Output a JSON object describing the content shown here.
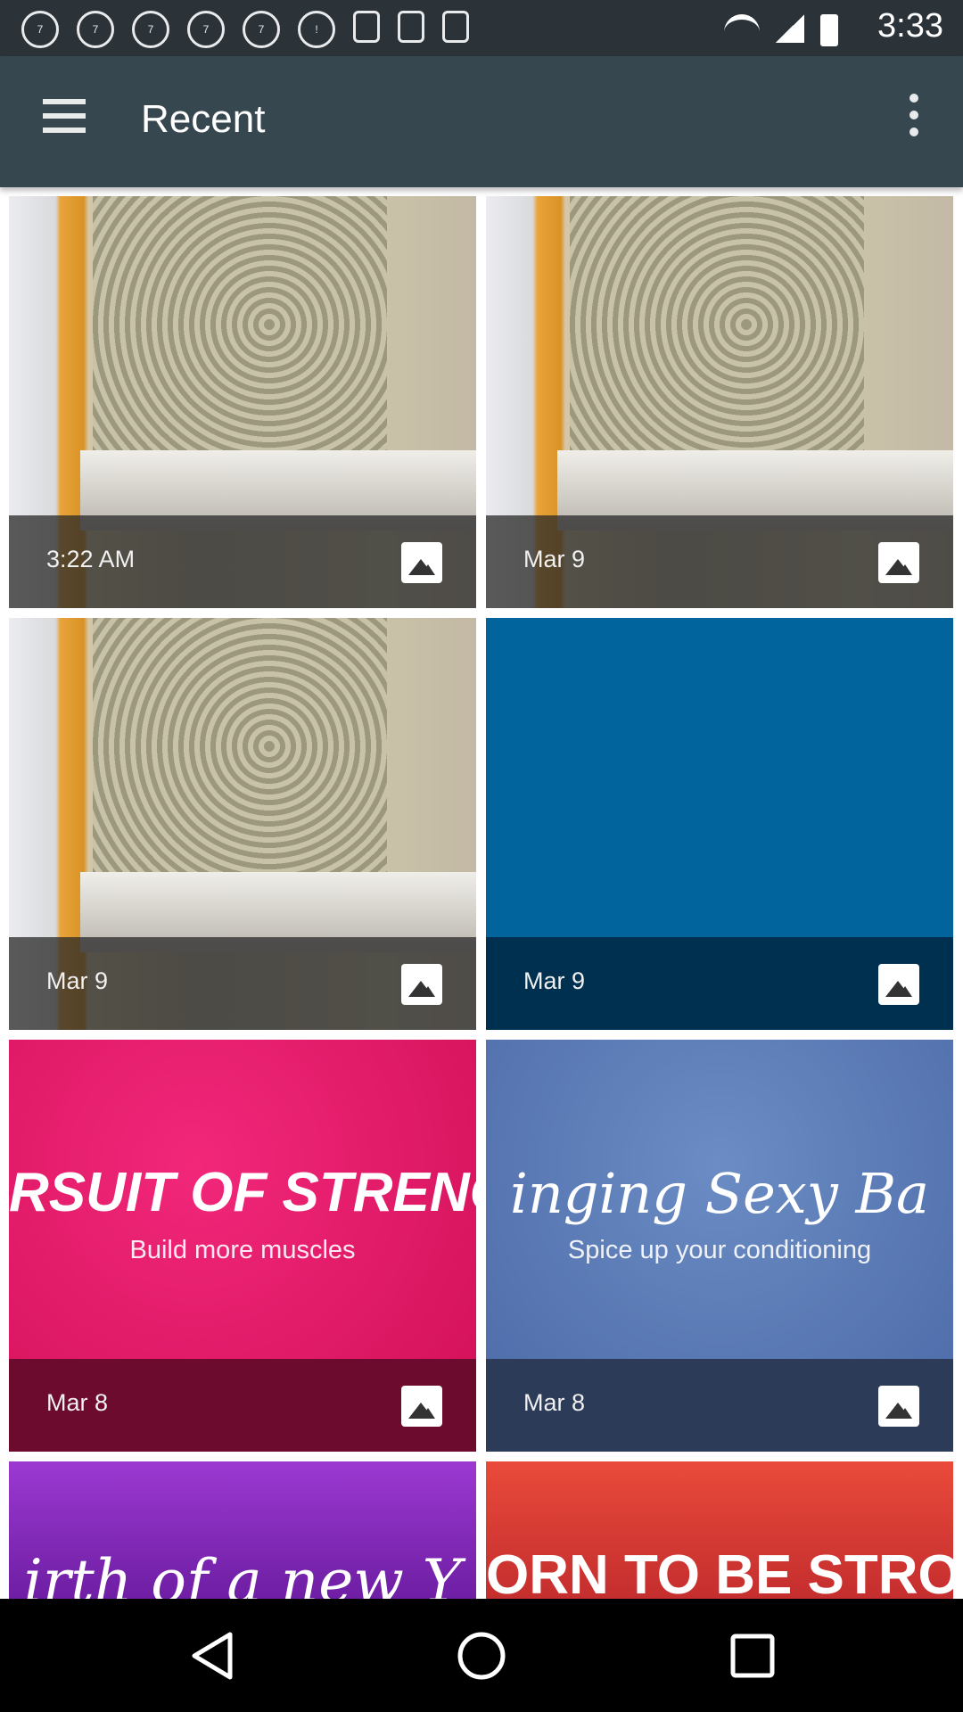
{
  "status_bar": {
    "time": "3:33",
    "icons": [
      "abc7-icon",
      "abc7-icon",
      "abc7-icon",
      "abc7-icon",
      "abc7-icon",
      "info-icon",
      "satellite-icon",
      "lock-icon",
      "android-icon"
    ]
  },
  "app_bar": {
    "title": "Recent"
  },
  "tiles": [
    {
      "date": "3:22 AM",
      "theme": "photo"
    },
    {
      "date": "Mar 9",
      "theme": "photo"
    },
    {
      "date": "Mar 9",
      "theme": "photo"
    },
    {
      "date": "Mar 9",
      "theme": "blue"
    },
    {
      "date": "Mar 8",
      "theme": "pink",
      "banner": "RSUIT OF STRENG",
      "subtitle": "Build more muscles"
    },
    {
      "date": "Mar 8",
      "theme": "slate",
      "banner": "inging Sexy Ba",
      "subtitle": "Spice up your conditioning"
    },
    {
      "date": "",
      "theme": "purple",
      "banner": "irth of a new Y"
    },
    {
      "date": "",
      "theme": "red",
      "banner": "ORN TO BE STRON"
    }
  ],
  "colors": {
    "status_bar": "#2b3238",
    "app_bar": "#37474f",
    "blue_tile": "#02649c",
    "pink_tile": "#d00f56"
  }
}
